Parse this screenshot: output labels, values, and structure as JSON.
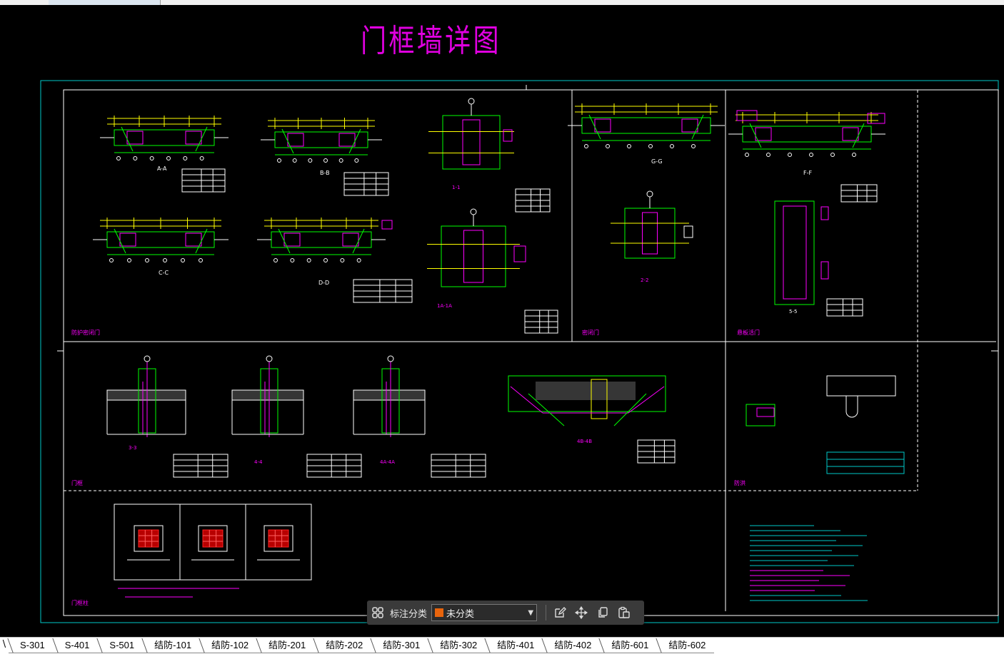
{
  "window": {
    "active_tab_label": ""
  },
  "drawing": {
    "title": "门框墙详图",
    "panel_labels": [
      "防护密闭门",
      "密闭门",
      "悬板活门",
      "门框",
      "门框柱",
      "防洪"
    ],
    "section_labels": [
      "A-A",
      "B-B",
      "C-C",
      "D-D",
      "1-1",
      "1A-1A",
      "G-G",
      "2-2",
      "F-F",
      "5-5",
      "3-3",
      "4-4",
      "4A-4A",
      "4B-4B"
    ]
  },
  "float_toolbar": {
    "category_label": "标注分类",
    "category_value": "未分类",
    "category_color": "#e8640c",
    "icons": [
      "grid-icon",
      "edit-icon",
      "move-icon",
      "copy-icon",
      "paste-icon"
    ]
  },
  "sheet_tabs": [
    "S-301",
    "S-401",
    "S-501",
    "结防-101",
    "结防-102",
    "结防-201",
    "结防-202",
    "结防-301",
    "结防-302",
    "结防-401",
    "结防-402",
    "结防-601",
    "结防-602"
  ],
  "colors": {
    "frame": "#00c8c8",
    "border": "#ffffff",
    "lines": "#00ff00",
    "accent": "#ff00ff",
    "dim": "#ffff00"
  }
}
